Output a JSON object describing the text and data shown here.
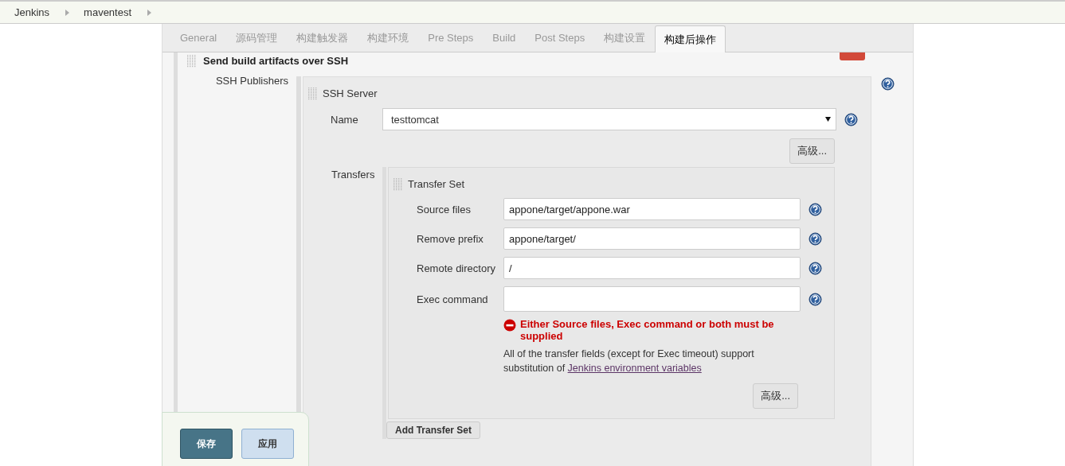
{
  "breadcrumb": [
    {
      "label": "Jenkins"
    },
    {
      "label": "maventest"
    }
  ],
  "tabs": [
    {
      "label": "General",
      "selected": false
    },
    {
      "label": "源码管理",
      "selected": false
    },
    {
      "label": "构建触发器",
      "selected": false
    },
    {
      "label": "构建环境",
      "selected": false
    },
    {
      "label": "Pre Steps",
      "selected": false
    },
    {
      "label": "Build",
      "selected": false
    },
    {
      "label": "Post Steps",
      "selected": false
    },
    {
      "label": "构建设置",
      "selected": false
    },
    {
      "label": "构建后操作",
      "selected": true
    }
  ],
  "section": {
    "title": "Send build artifacts over SSH",
    "publishers_label": "SSH Publishers",
    "server": {
      "title": "SSH Server",
      "name_label": "Name",
      "name_value": "testtomcat",
      "advanced": "高级...",
      "transfers_label": "Transfers",
      "transfer_set": {
        "title": "Transfer Set",
        "fields": [
          {
            "label": "Source files",
            "value": "appone/target/appone.war",
            "kind": "text"
          },
          {
            "label": "Remove prefix",
            "value": "appone/target/",
            "kind": "text"
          },
          {
            "label": "Remote directory",
            "value": "/",
            "kind": "text"
          },
          {
            "label": "Exec command",
            "kind": "textarea"
          }
        ],
        "error": "Either Source files, Exec command or both must be supplied",
        "note": "All of the transfer fields (except for Exec timeout) support substitution of ",
        "note_link": "Jenkins environment variables",
        "advanced": "高级..."
      },
      "add_button": "Add Transfer Set"
    }
  },
  "footer": {
    "save": "保存",
    "apply": "应用"
  }
}
